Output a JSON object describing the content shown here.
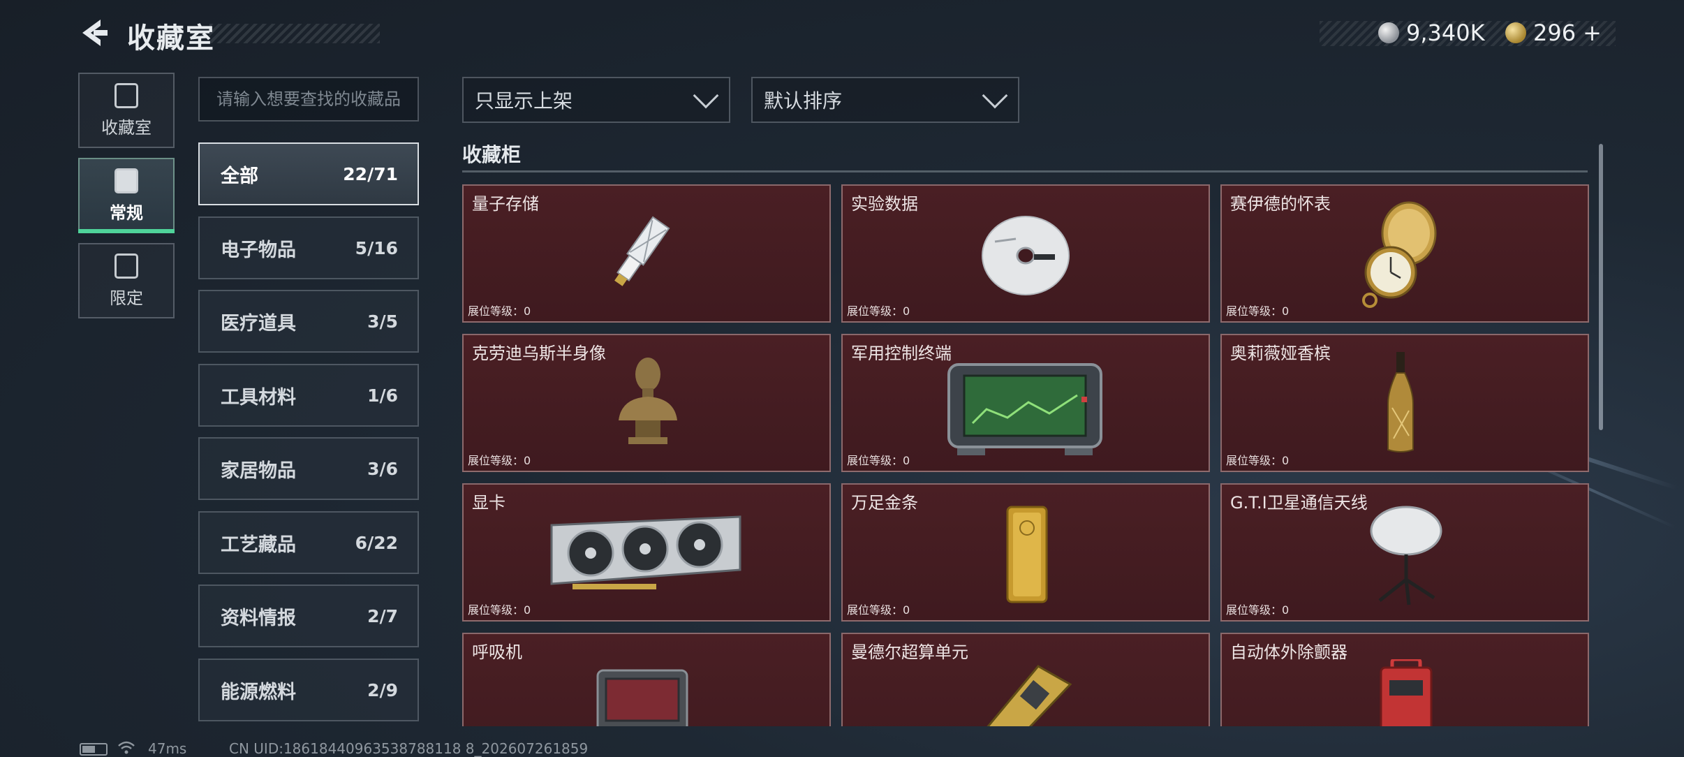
{
  "header": {
    "title": "收藏室",
    "currency_silver": "9,340K",
    "currency_gold": "296",
    "currency_add": "+"
  },
  "nav": {
    "tabs": [
      {
        "label": "收藏室",
        "icon": "collection-room-icon",
        "active": false
      },
      {
        "label": "常规",
        "icon": "regular-gallery-icon",
        "active": true
      },
      {
        "label": "限定",
        "icon": "limited-gallery-icon",
        "active": false
      }
    ]
  },
  "search": {
    "placeholder": "请输入想要查找的收藏品"
  },
  "categories": [
    {
      "name": "全部",
      "count": "22/71",
      "active": true
    },
    {
      "name": "电子物品",
      "count": "5/16",
      "active": false
    },
    {
      "name": "医疗道具",
      "count": "3/5",
      "active": false
    },
    {
      "name": "工具材料",
      "count": "1/6",
      "active": false
    },
    {
      "name": "家居物品",
      "count": "3/6",
      "active": false
    },
    {
      "name": "工艺藏品",
      "count": "6/22",
      "active": false
    },
    {
      "name": "资料情报",
      "count": "2/7",
      "active": false
    },
    {
      "name": "能源燃料",
      "count": "2/9",
      "active": false
    }
  ],
  "filters": {
    "display": "只显示上架",
    "sort": "默认排序"
  },
  "section": {
    "title": "收藏柜"
  },
  "items": [
    {
      "name": "量子存储",
      "level": "展位等级：0",
      "icon": "usb-drive-icon"
    },
    {
      "name": "实验数据",
      "level": "展位等级：0",
      "icon": "disc-icon"
    },
    {
      "name": "赛伊德的怀表",
      "level": "展位等级：0",
      "icon": "pocket-watch-icon"
    },
    {
      "name": "克劳迪乌斯半身像",
      "level": "展位等级：0",
      "icon": "bust-icon"
    },
    {
      "name": "军用控制终端",
      "level": "展位等级：0",
      "icon": "control-terminal-icon"
    },
    {
      "name": "奥莉薇娅香槟",
      "level": "展位等级：0",
      "icon": "champagne-icon"
    },
    {
      "name": "显卡",
      "level": "展位等级：0",
      "icon": "graphics-card-icon"
    },
    {
      "name": "万足金条",
      "level": "展位等级：0",
      "icon": "gold-bar-icon"
    },
    {
      "name": "G.T.I卫星通信天线",
      "level": "展位等级：0",
      "icon": "satellite-dish-icon"
    },
    {
      "name": "呼吸机",
      "level": "",
      "icon": "ventilator-icon"
    },
    {
      "name": "曼德尔超算单元",
      "level": "",
      "icon": "supercomputer-unit-icon"
    },
    {
      "name": "自动体外除颤器",
      "level": "",
      "icon": "defibrillator-icon"
    }
  ],
  "status": {
    "ping": "47ms",
    "uid": "CN UID:18618440963538788118 8_202607261859"
  },
  "colors": {
    "card_bg": "#4a1f24",
    "active_tab_underline": "#4fd39a"
  }
}
